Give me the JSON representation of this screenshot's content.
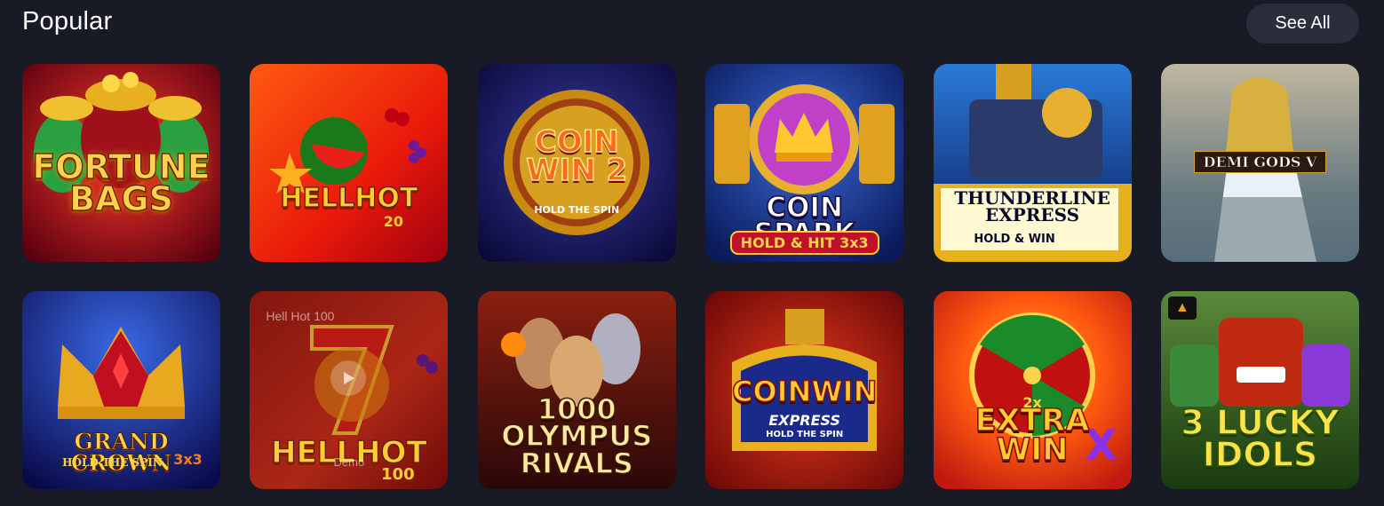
{
  "section": {
    "title": "Popular",
    "see_all_label": "See All"
  },
  "games": [
    {
      "title": "FORTUNE\nBAGS",
      "subtitle": "",
      "icon": "money-bags-icon"
    },
    {
      "title": "HELLHOT",
      "subtitle": "20",
      "icon": "watermelon-icon"
    },
    {
      "title": "COIN\nWIN 2",
      "subtitle": "HOLD THE SPIN",
      "icon": "gold-coin-icon"
    },
    {
      "title": "COIN SPARK",
      "subtitle": "HOLD & HIT 3x3",
      "icon": "crown-icon"
    },
    {
      "title": "THUNDERLINE\nEXPRESS",
      "subtitle": "HOLD & WIN",
      "icon": "train-icon"
    },
    {
      "title": "DEMI GODS V",
      "subtitle": "",
      "icon": "goddess-icon"
    },
    {
      "title": "GRAND CROWN",
      "subtitle": "HOLD THE SPIN",
      "badge": "3x3",
      "icon": "crown-icon"
    },
    {
      "title": "HELLHOT",
      "subtitle": "100",
      "icon": "seven-icon",
      "hover_name": "Hell Hot 100",
      "hover_action": "Demo"
    },
    {
      "title": "1000\nOLYMPUS\nRIVALS",
      "subtitle": "",
      "icon": "gods-icon"
    },
    {
      "title": "COINWIN",
      "subtitle": "EXPRESS",
      "tagline": "HOLD THE SPIN",
      "icon": "train-icon"
    },
    {
      "title": "EXTRA\nWIN",
      "subtitle": "2x",
      "icon": "wheel-icon"
    },
    {
      "title": "3 LUCKY\nIDOLS",
      "subtitle": "",
      "icon": "tiki-mask-icon"
    }
  ],
  "colors": {
    "background": "#181a25",
    "button_bg": "#2a2d3b"
  }
}
